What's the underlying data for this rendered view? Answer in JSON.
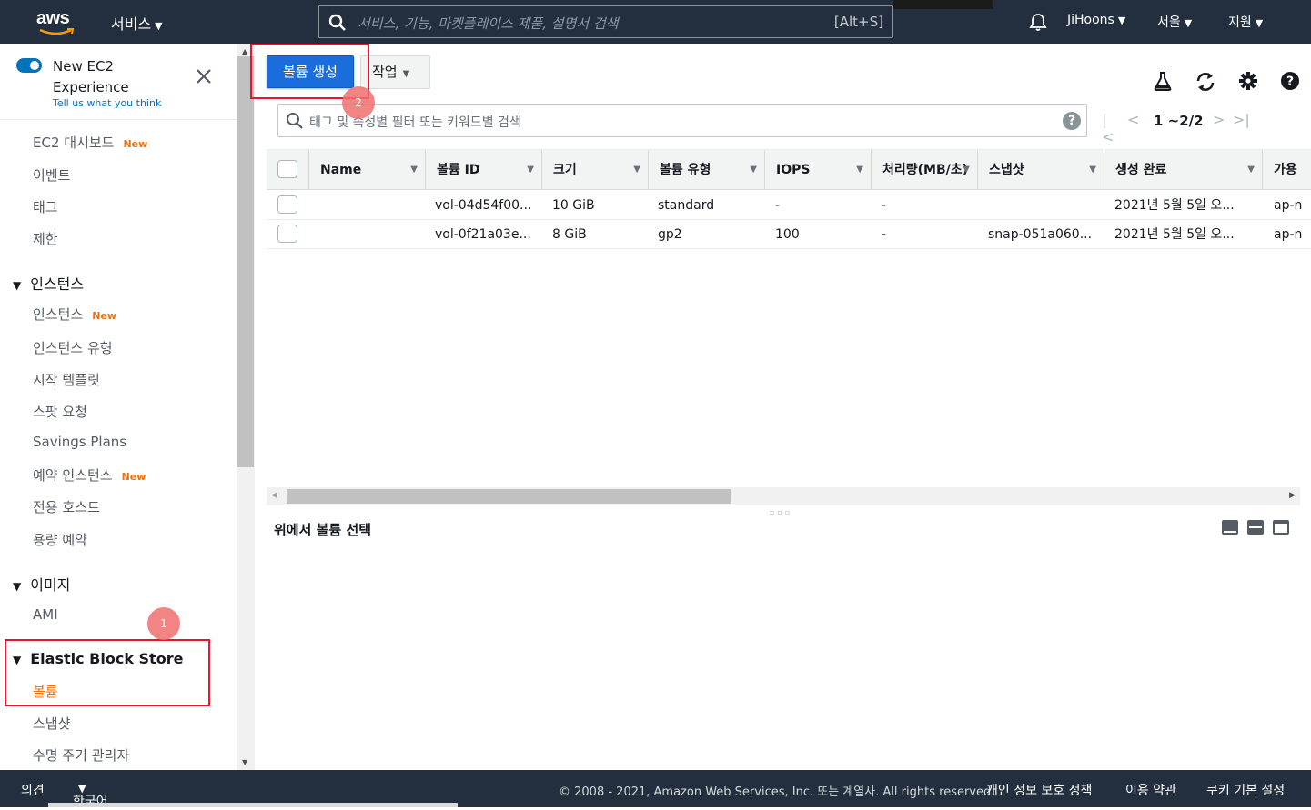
{
  "topnav": {
    "logo": "aws",
    "services": "서비스",
    "search_placeholder": "서비스, 기능, 마켓플레이스 제품, 설명서 검색",
    "search_shortcut": "[Alt+S]",
    "user": "JiHoons",
    "region": "서울",
    "support": "지원"
  },
  "sidebar": {
    "new_experience": "New EC2 Experience",
    "tell_us": "Tell us what you think",
    "items": {
      "dashboard": "EC2 대시보드",
      "events": "이벤트",
      "tags": "태그",
      "limits": "제한",
      "sec_instances": "인스턴스",
      "instances": "인스턴스",
      "instance_types": "인스턴스 유형",
      "launch_templates": "시작 템플릿",
      "spot_requests": "스팟 요청",
      "savings_plans": "Savings Plans",
      "reserved": "예약 인스턴스",
      "dedicated_hosts": "전용 호스트",
      "capacity": "용량 예약",
      "sec_images": "이미지",
      "ami": "AMI",
      "sec_ebs": "Elastic Block Store",
      "volumes": "볼륨",
      "snapshots": "스냅샷",
      "lifecycle": "수명 주기 관리자"
    },
    "new_badge": "New"
  },
  "toolbar": {
    "create_volume": "볼륨 생성",
    "actions": "작업"
  },
  "filter": {
    "placeholder": "태그 및 속성별 필터 또는 키워드별 검색",
    "help": "?"
  },
  "pager": {
    "range": "1 ~2/2"
  },
  "table": {
    "columns": [
      "Name",
      "볼륨 ID",
      "크기",
      "볼륨 유형",
      "IOPS",
      "처리량(MB/초)",
      "스냅샷",
      "생성 완료",
      "가용"
    ],
    "rows": [
      [
        "",
        "vol-04d54f00...",
        "10 GiB",
        "standard",
        "-",
        "-",
        "",
        "2021년 5월 5일 오...",
        "ap-n"
      ],
      [
        "",
        "vol-0f21a03e...",
        "8 GiB",
        "gp2",
        "100",
        "-",
        "snap-051a060...",
        "2021년 5월 5일 오...",
        "ap-n"
      ]
    ]
  },
  "detail": {
    "select_message": "위에서 볼륨 선택"
  },
  "footer": {
    "feedback": "의견",
    "language": "한국어",
    "copyright": "© 2008 - 2021, Amazon Web Services, Inc. 또는 계열사. All rights reserved.",
    "privacy": "개인 정보 보호 정책",
    "terms": "이용 약관",
    "cookies": "쿠키 기본 설정"
  },
  "annotations": {
    "step1": "1",
    "step2": "2"
  },
  "colors": {
    "nav_bg": "#232f3e",
    "primary": "#1a6ddb",
    "accent": "#ec7211",
    "annotation": "#e8162c"
  }
}
